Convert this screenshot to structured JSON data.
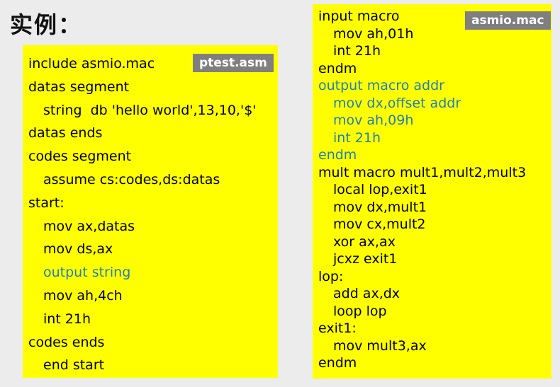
{
  "title": "实例：",
  "left_panel": {
    "filename": "ptest.asm",
    "lines": [
      {
        "text": "include asmio.mac",
        "indent": false,
        "highlight": false
      },
      {
        "text": "datas segment",
        "indent": false,
        "highlight": false
      },
      {
        "text": "string  db 'hello world',13,10,'$'",
        "indent": true,
        "highlight": false
      },
      {
        "text": "datas ends",
        "indent": false,
        "highlight": false
      },
      {
        "text": "codes segment",
        "indent": false,
        "highlight": false
      },
      {
        "text": "assume cs:codes,ds:datas",
        "indent": true,
        "highlight": false
      },
      {
        "text": "start:",
        "indent": false,
        "highlight": false
      },
      {
        "text": "mov ax,datas",
        "indent": true,
        "highlight": false
      },
      {
        "text": "mov ds,ax",
        "indent": true,
        "highlight": false
      },
      {
        "text": "output string",
        "indent": true,
        "highlight": true
      },
      {
        "text": "mov ah,4ch",
        "indent": true,
        "highlight": false
      },
      {
        "text": "int 21h",
        "indent": true,
        "highlight": false
      },
      {
        "text": "codes ends",
        "indent": false,
        "highlight": false
      },
      {
        "text": "end start",
        "indent": true,
        "highlight": false
      }
    ]
  },
  "right_panel": {
    "filename": "asmio.mac",
    "lines": [
      {
        "text": "input macro",
        "indent": false,
        "highlight": false
      },
      {
        "text": "mov ah,01h",
        "indent": true,
        "highlight": false
      },
      {
        "text": "int 21h",
        "indent": true,
        "highlight": false
      },
      {
        "text": "endm",
        "indent": false,
        "highlight": false
      },
      {
        "text": "output macro addr",
        "indent": false,
        "highlight": true
      },
      {
        "text": "mov dx,offset addr",
        "indent": true,
        "highlight": true
      },
      {
        "text": "mov ah,09h",
        "indent": true,
        "highlight": true
      },
      {
        "text": "int 21h",
        "indent": true,
        "highlight": true
      },
      {
        "text": "endm",
        "indent": false,
        "highlight": true
      },
      {
        "text": "mult macro mult1,mult2,mult3",
        "indent": false,
        "highlight": false
      },
      {
        "text": "local lop,exit1",
        "indent": true,
        "highlight": false
      },
      {
        "text": "mov dx,mult1",
        "indent": true,
        "highlight": false
      },
      {
        "text": "mov cx,mult2",
        "indent": true,
        "highlight": false
      },
      {
        "text": "xor ax,ax",
        "indent": true,
        "highlight": false
      },
      {
        "text": "jcxz exit1",
        "indent": true,
        "highlight": false
      },
      {
        "text": "lop:",
        "indent": false,
        "highlight": false
      },
      {
        "text": "add ax,dx",
        "indent": true,
        "highlight": false
      },
      {
        "text": "loop lop",
        "indent": true,
        "highlight": false
      },
      {
        "text": "exit1:",
        "indent": false,
        "highlight": false
      },
      {
        "text": "mov mult3,ax",
        "indent": true,
        "highlight": false
      },
      {
        "text": "endm",
        "indent": false,
        "highlight": false
      }
    ]
  },
  "colors": {
    "panel_background": "#ffff00",
    "highlight_text": "#1f7fb8",
    "filename_tag": "#7f7f7f"
  }
}
